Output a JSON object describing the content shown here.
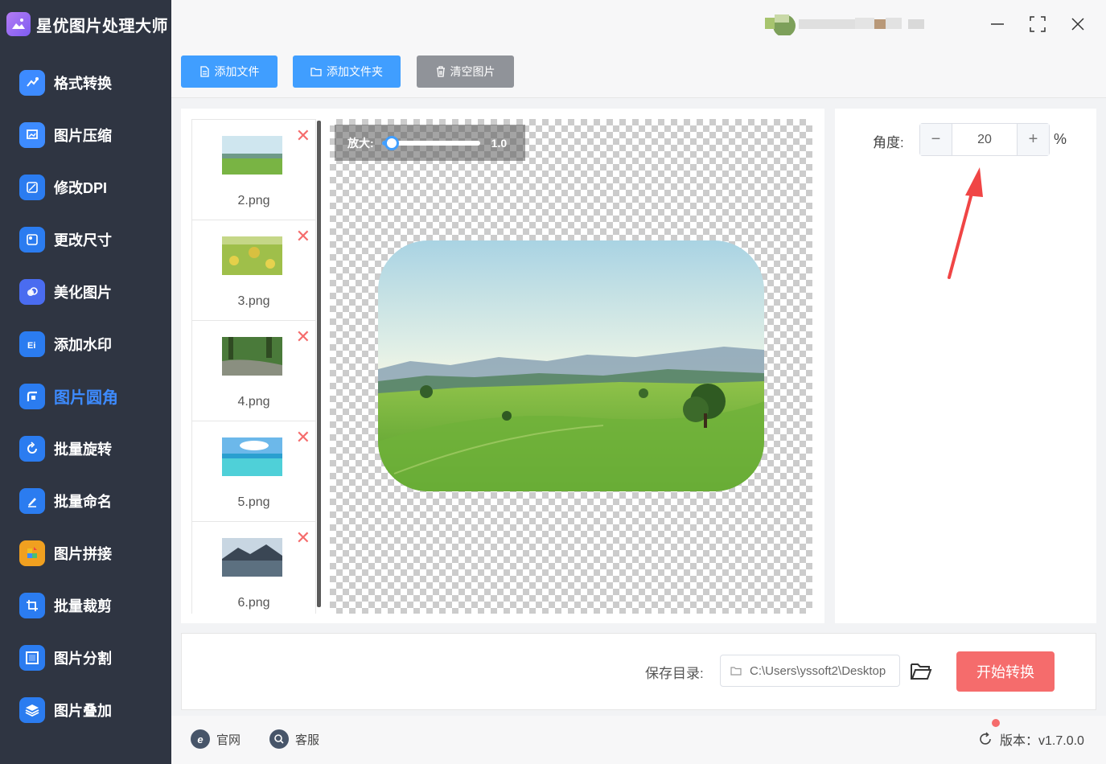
{
  "app": {
    "title": "星优图片处理大师"
  },
  "sidebar": {
    "items": [
      {
        "label": "格式转换",
        "icon": "format-convert-icon",
        "color": "#3d8bff",
        "active": false
      },
      {
        "label": "图片压缩",
        "icon": "image-compress-icon",
        "color": "#3d8bff",
        "active": false
      },
      {
        "label": "修改DPI",
        "icon": "dpi-icon",
        "color": "#2b7cf0",
        "active": false
      },
      {
        "label": "更改尺寸",
        "icon": "resize-icon",
        "color": "#2b7cf0",
        "active": false
      },
      {
        "label": "美化图片",
        "icon": "beautify-icon",
        "color": "#4a6cf0",
        "active": false
      },
      {
        "label": "添加水印",
        "icon": "watermark-icon",
        "color": "#2b7cf0",
        "active": false
      },
      {
        "label": "图片圆角",
        "icon": "round-corner-icon",
        "color": "#2b7cf0",
        "active": true
      },
      {
        "label": "批量旋转",
        "icon": "rotate-icon",
        "color": "#2b7cf0",
        "active": false
      },
      {
        "label": "批量命名",
        "icon": "rename-icon",
        "color": "#2b7cf0",
        "active": false
      },
      {
        "label": "图片拼接",
        "icon": "puzzle-icon",
        "color": "#f0a020",
        "active": false
      },
      {
        "label": "批量裁剪",
        "icon": "crop-icon",
        "color": "#2b7cf0",
        "active": false
      },
      {
        "label": "图片分割",
        "icon": "split-icon",
        "color": "#2b7cf0",
        "active": false
      },
      {
        "label": "图片叠加",
        "icon": "layers-icon",
        "color": "#2b7cf0",
        "active": false
      }
    ]
  },
  "toolbar": {
    "add_file": "添加文件",
    "add_folder": "添加文件夹",
    "clear": "清空图片"
  },
  "files": [
    {
      "name": "2.png",
      "thumb": "meadow"
    },
    {
      "name": "3.png",
      "thumb": "flowers"
    },
    {
      "name": "4.png",
      "thumb": "stream"
    },
    {
      "name": "5.png",
      "thumb": "sea"
    },
    {
      "name": "6.png",
      "thumb": "lake"
    }
  ],
  "zoom": {
    "label": "放大:",
    "value": "1.0",
    "level": 0.1
  },
  "settings": {
    "angle_label": "角度:",
    "angle_value": "20",
    "unit": "%",
    "minus": "−",
    "plus": "+"
  },
  "save": {
    "label": "保存目录:",
    "path": "C:\\Users\\yssoft2\\Desktop",
    "start_button": "开始转换"
  },
  "footer": {
    "website": "官网",
    "support": "客服",
    "version": "版本：v1.7.0.0"
  },
  "colors": {
    "sidebar_bg": "#2f3542",
    "primary": "#409eff",
    "danger": "#f56c6c",
    "active_nav": "#3d8bff"
  }
}
